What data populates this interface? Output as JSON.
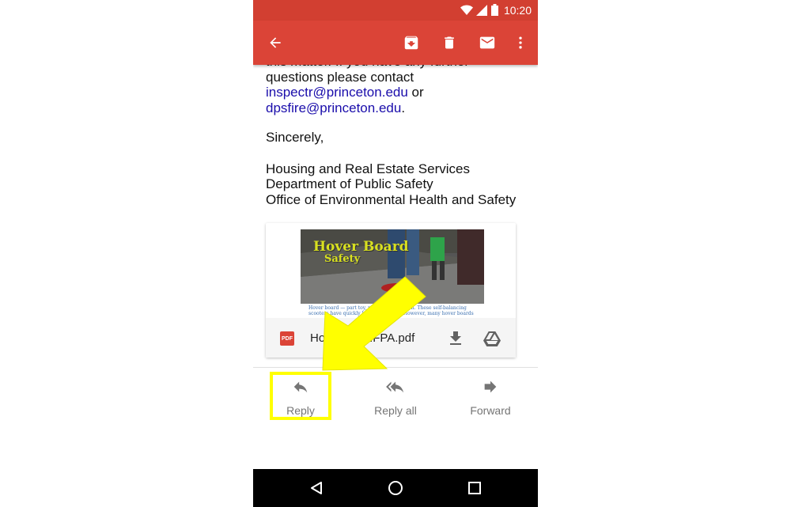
{
  "status_bar": {
    "time": "10:20"
  },
  "toolbar": {
    "icons": [
      "back-arrow-icon",
      "archive-icon",
      "delete-icon",
      "mark-unread-icon",
      "more-vert-icon"
    ]
  },
  "message": {
    "cut_line": "this matter. If you have any further",
    "line2": "questions please contact",
    "email1": "inspectr@princeton.edu",
    "or_text": " or",
    "email2": "dpsfire@princeton.edu",
    "period": ".",
    "closing": "Sincerely,",
    "signature": [
      "Housing and Real Estate Services",
      "Department of Public Safety",
      "Office of Environmental Health and Safety"
    ]
  },
  "attachment": {
    "thumbnail_title_line1": "Hover Board",
    "thumbnail_title_line2": "Safety",
    "thumbnail_caption": "Hover board — part toy, part transportation. These self-balancing scooters have quickly become popular. However, many hover boards",
    "file_type": "PDF",
    "file_name": "Hove        NFPA.pdf",
    "icons": [
      "download-icon",
      "drive-icon"
    ]
  },
  "actions": [
    {
      "label": "Reply",
      "icon": "reply-icon"
    },
    {
      "label": "Reply all",
      "icon": "reply-all-icon"
    },
    {
      "label": "Forward",
      "icon": "forward-icon"
    }
  ],
  "annotation": {
    "highlight_color": "#ffff00",
    "arrow_color": "#ffff00"
  },
  "colors": {
    "toolbar": "#db4437",
    "status_bar": "#d23f31",
    "link": "#1a0dab"
  }
}
